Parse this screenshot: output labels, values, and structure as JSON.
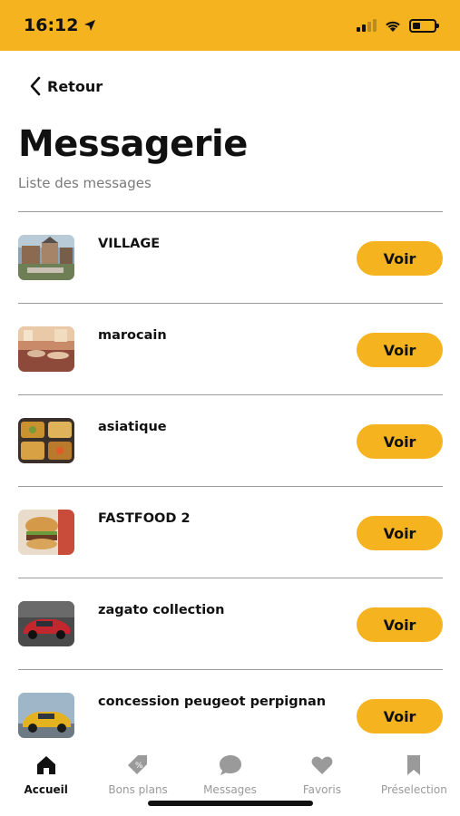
{
  "status": {
    "time": "16:12"
  },
  "header": {
    "back_label": "Retour",
    "title": "Messagerie",
    "subtitle": "Liste des messages"
  },
  "messages": [
    {
      "title": "VILLAGE",
      "action": "Voir",
      "thumb": "village-photo"
    },
    {
      "title": "marocain",
      "action": "Voir",
      "thumb": "restaurant-interior-photo"
    },
    {
      "title": "asiatique",
      "action": "Voir",
      "thumb": "asian-food-photo"
    },
    {
      "title": "FASTFOOD 2",
      "action": "Voir",
      "thumb": "burger-photo"
    },
    {
      "title": "zagato collection",
      "action": "Voir",
      "thumb": "red-car-photo"
    },
    {
      "title": "concession peugeot perpignan",
      "action": "Voir",
      "thumb": "yellow-car-photo"
    }
  ],
  "tabbar": {
    "items": [
      {
        "label": "Accueil",
        "icon": "home-icon",
        "active": true
      },
      {
        "label": "Bons plans",
        "icon": "price-tag-icon",
        "active": false
      },
      {
        "label": "Messages",
        "icon": "chat-bubble-icon",
        "active": false
      },
      {
        "label": "Favoris",
        "icon": "heart-icon",
        "active": false
      },
      {
        "label": "Préselection",
        "icon": "bookmark-icon",
        "active": false
      }
    ]
  },
  "colors": {
    "accent": "#f6b320",
    "divider": "#9a9a9a",
    "muted": "#7a7a7a"
  }
}
